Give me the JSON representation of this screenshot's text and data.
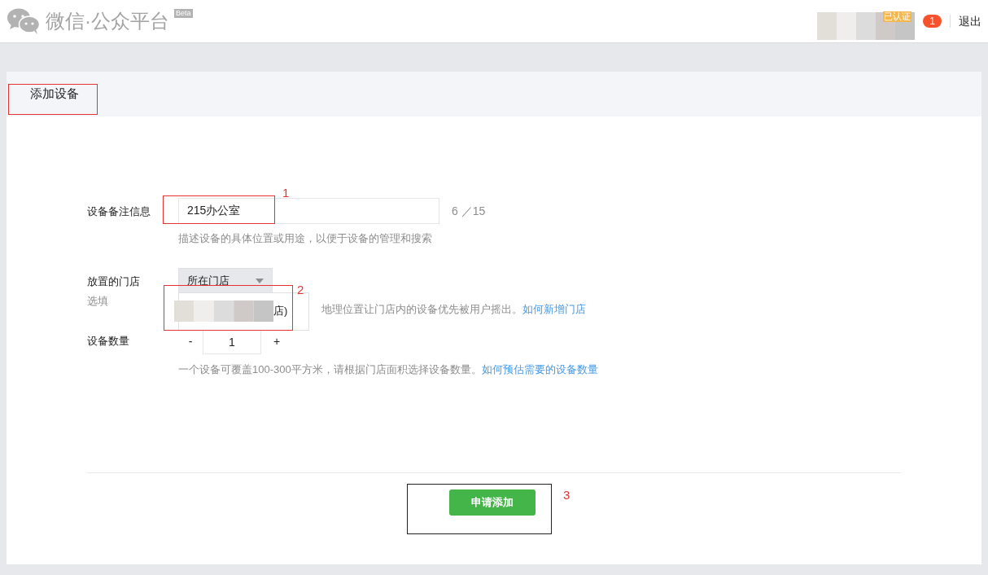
{
  "header": {
    "logo_text": "微信·公众平台",
    "beta": "Beta",
    "verified_tag": "已认证",
    "notification_count": "1",
    "logout": "退出"
  },
  "panel": {
    "title": "添加设备"
  },
  "form": {
    "remark": {
      "label": "设备备注信息",
      "value": "215办公室",
      "counter": "6 ／15",
      "hint": "描述设备的具体位置或用途，以便于设备的管理和搜索"
    },
    "store": {
      "label": "放置的门店",
      "optional": "选填",
      "select": "所在门店",
      "option_visible": "店)",
      "hint": "地理位置让门店内的设备优先被用户摇出。",
      "link": "如何新增门店"
    },
    "quantity": {
      "label": "设备数量",
      "minus": "-",
      "value": "1",
      "plus": "+",
      "hint": "一个设备可覆盖100-300平方米，请根据门店面积选择设备数量。",
      "link": "如何预估需要的设备数量"
    }
  },
  "submit": "申请添加",
  "annotations": [
    "1",
    "2",
    "3"
  ]
}
